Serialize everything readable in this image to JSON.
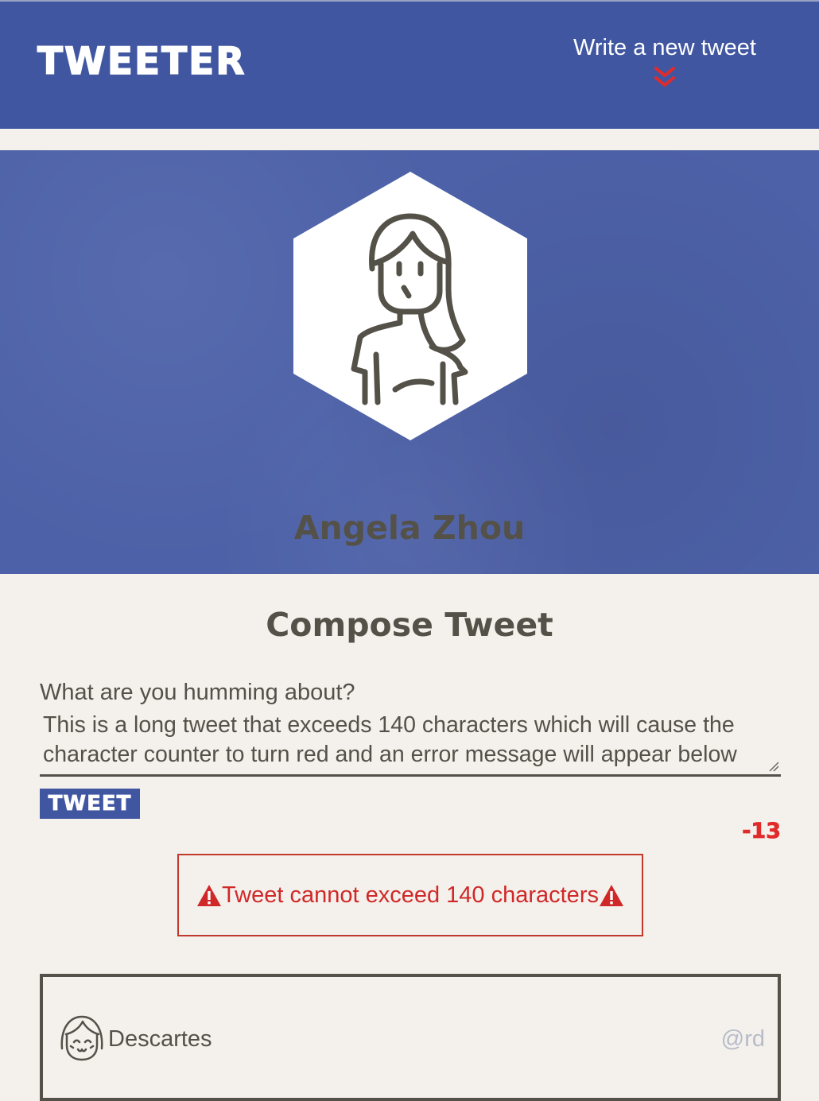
{
  "colors": {
    "nav_bg": "#4056a1",
    "profile_bg": "#4d61a8",
    "page_bg": "#f4f1ec",
    "text": "#545149",
    "error": "#d02828",
    "counter_negative": "#e12b2b",
    "handle": "#b7bbc9"
  },
  "nav": {
    "brand": "TWEETER",
    "write_new_label": "Write a new tweet",
    "write_new_icon": "double-chevron-down-icon"
  },
  "profile": {
    "name": "Angela Zhou",
    "avatar_icon": "girl-avatar-icon"
  },
  "compose": {
    "title": "Compose Tweet",
    "label": "What are you humming about?",
    "text_value": "This is a long tweet that exceeds 140 characters which will cause the character counter to turn red and an error message will appear below",
    "button_label": "TWEET",
    "counter": "-13"
  },
  "error": {
    "message": "Tweet cannot exceed 140 characters",
    "icon": "warning-triangle-icon"
  },
  "tweets": [
    {
      "name": "Descartes",
      "handle": "@rd",
      "avatar_icon": "smiling-avatar-icon"
    }
  ]
}
